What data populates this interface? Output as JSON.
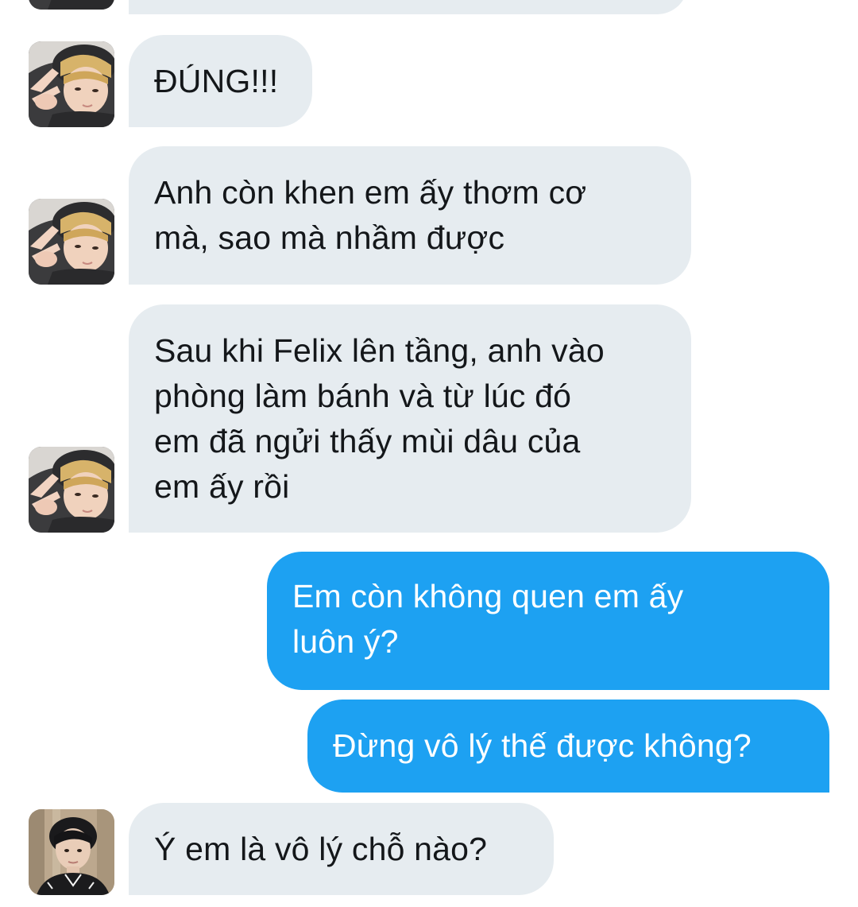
{
  "conversation": {
    "messages": [
      {
        "id": "m0",
        "sender": "contact",
        "avatar": "blond-hood-peace-sign-avatar",
        "lines": []
      },
      {
        "id": "m1",
        "sender": "contact",
        "avatar": "blond-hood-peace-sign-avatar",
        "lines": [
          "ĐÚNG!!!"
        ]
      },
      {
        "id": "m2",
        "sender": "contact",
        "avatar": "blond-hood-peace-sign-avatar",
        "lines": [
          "Anh còn khen em ấy thơm cơ",
          "mà, sao mà nhầm được"
        ]
      },
      {
        "id": "m3",
        "sender": "contact",
        "avatar": "blond-hood-peace-sign-avatar",
        "lines": [
          "Sau khi Felix lên tầng, anh vào",
          "phòng làm bánh và từ lúc đó",
          "em đã ngửi thấy mùi dâu của",
          "em ấy rồi"
        ]
      },
      {
        "id": "m4",
        "sender": "me",
        "lines": [
          "Em còn không quen em ấy",
          "luôn ý?"
        ]
      },
      {
        "id": "m5",
        "sender": "me",
        "lines": [
          "Đừng vô lý thế được không?"
        ]
      },
      {
        "id": "m6",
        "sender": "contact",
        "avatar": "dark-hair-portrait-avatar",
        "lines": [
          "Ý em là vô lý chỗ nào?"
        ]
      }
    ]
  },
  "colors": {
    "incoming_bubble": "#e6ecf0",
    "incoming_text": "#14171a",
    "outgoing_bubble": "#1da1f2",
    "outgoing_text": "#ffffff",
    "background": "#ffffff"
  }
}
